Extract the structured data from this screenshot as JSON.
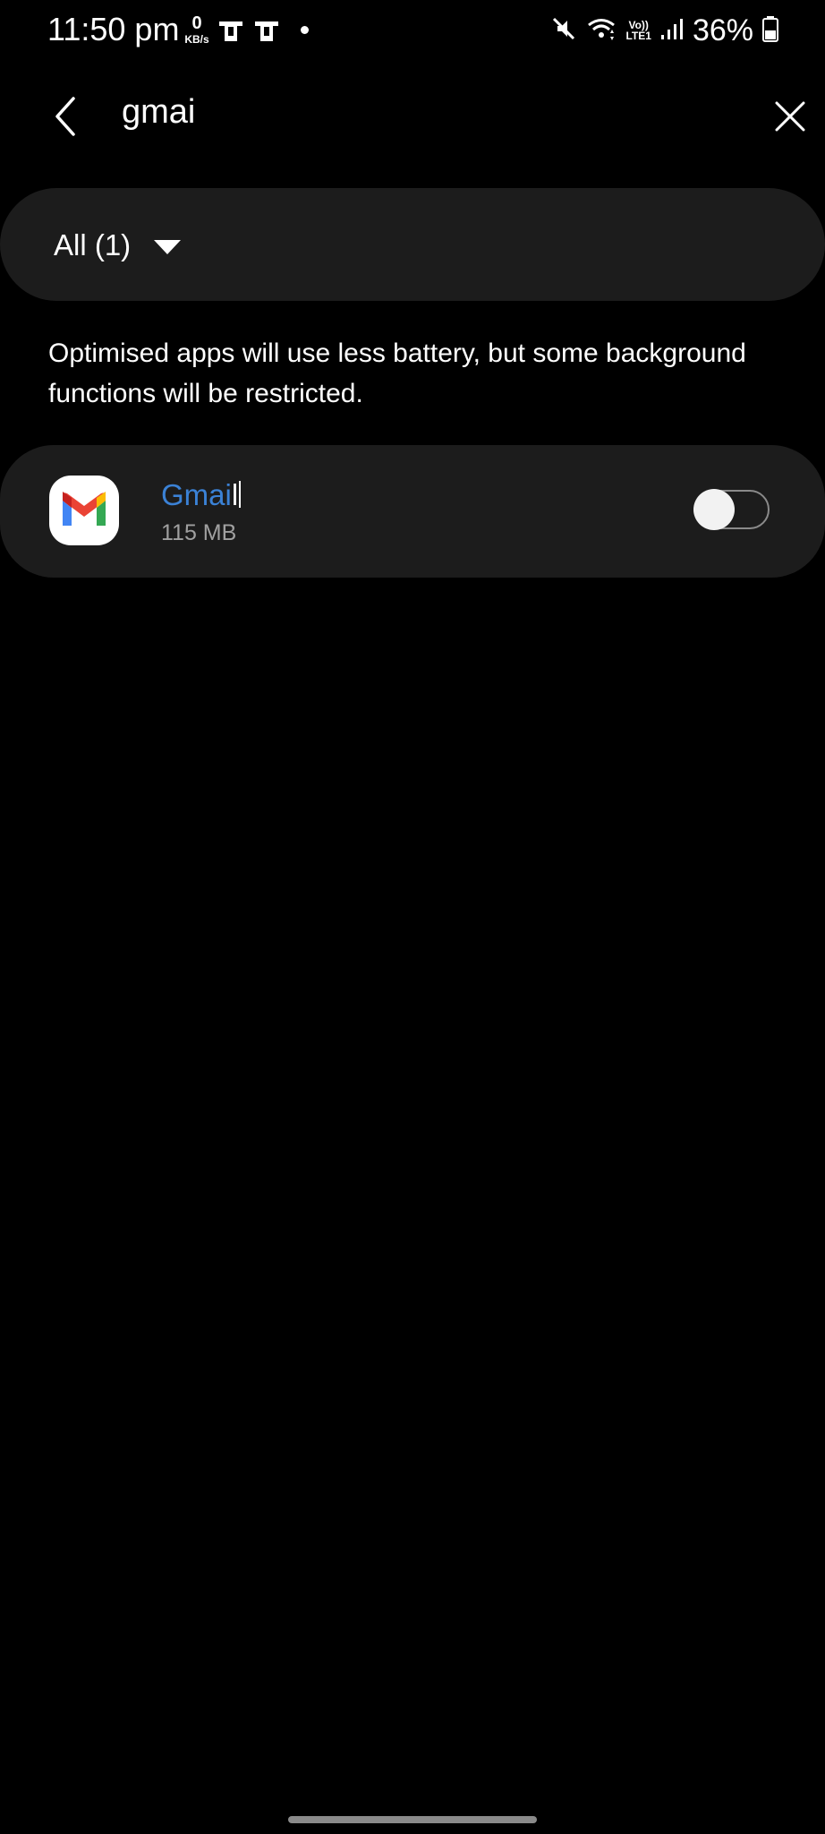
{
  "status_bar": {
    "time": "11:50 pm",
    "net_speed_value": "0",
    "net_speed_unit": "KB/s",
    "volte_line1": "Vo))",
    "volte_line2": "LTE1",
    "battery_percent": "36%",
    "icons": [
      "sim-card-icon",
      "sim-card-icon",
      "notification-dot-icon",
      "mute-icon",
      "wifi-icon",
      "volte-icon",
      "signal-icon",
      "battery-icon"
    ]
  },
  "search": {
    "query": "gmai"
  },
  "filter": {
    "label": "All (1)"
  },
  "info_text": "Optimised apps will use less battery, but some background functions will be restricted.",
  "apps": [
    {
      "name_match": "Gmai",
      "name_rest": "l",
      "size": "115 MB",
      "optimised": false,
      "icon": "gmail-icon"
    }
  ],
  "colors": {
    "background": "#000000",
    "card": "#1c1c1c",
    "highlight": "#3b82d6"
  }
}
